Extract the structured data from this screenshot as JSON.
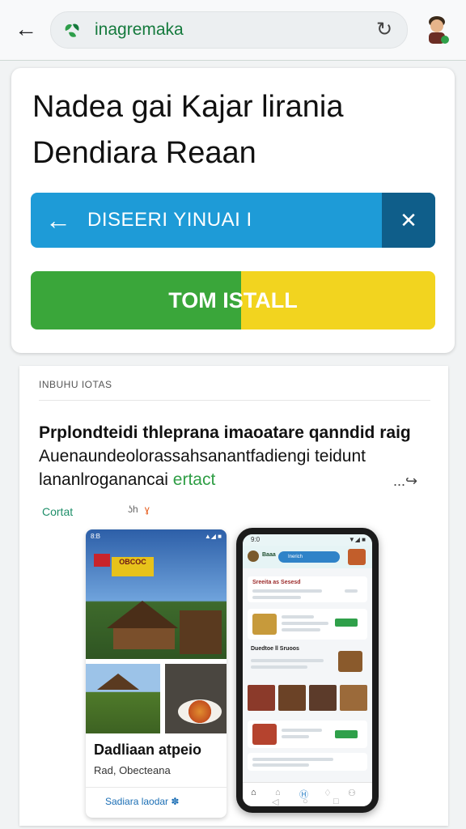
{
  "browser": {
    "url_text": "inagremaka",
    "back_symbol": "←",
    "reload_symbol": "↻"
  },
  "hero": {
    "headline_line1": "Nadea gai Kajar lirania",
    "headline_line2": "Dendiara Reaan",
    "info_bar_arrow": "←",
    "info_bar_text": "DISEERI YINUAI I",
    "info_bar_close": "✕",
    "install_button_label": "TOM ISTALL",
    "install_colors": [
      "#3aa63a",
      "#f2d41f"
    ],
    "info_bar_colors": [
      "#1e9bd7",
      "#0f5e8a"
    ]
  },
  "article": {
    "section_label": "INBUHU IOTAS",
    "line1": "Prplondteidi thleprana imaoatare qanndid raig",
    "line2": "Auenaundeolorassahsanantfadiengi teidunt",
    "line3_text": "lananlroganancai ",
    "line3_link": "ertact",
    "share_icon": "...↪",
    "contact_label": "Cortat",
    "mini_icon_a": "ʖh",
    "mini_icon_b": "ɣ"
  },
  "left_mockup": {
    "status_left": "8:B",
    "status_right": "▲◢ ■",
    "poster_text": "OBCOC",
    "title": "Dadliaan atpeio",
    "subtitle": "Rad, Obecteana",
    "footer_text": "Sadiara laodar ✽"
  },
  "phone_mockup": {
    "status_left": "9:0",
    "status_right": "▼◢ ■",
    "brand": "Baaa",
    "search_text": "Inerich",
    "card1_heading": "Sreeita as Sesesd",
    "section_heading": "Duedtoe ll Sruoos",
    "nav_icons": [
      "⌂",
      "⌂",
      "Ⓗ",
      "♢",
      "⚇"
    ],
    "bottom_icons": [
      "◁",
      "○",
      "□"
    ]
  }
}
